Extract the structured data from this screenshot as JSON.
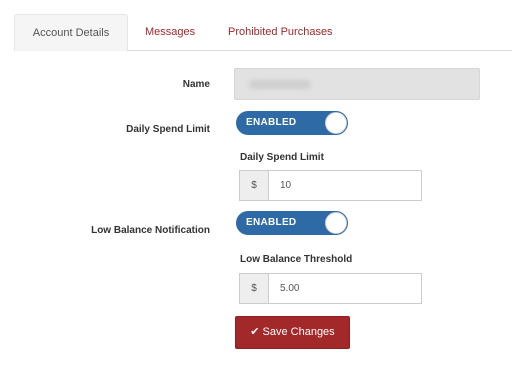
{
  "tabs": [
    {
      "label": "Account Details",
      "active": true
    },
    {
      "label": "Messages",
      "active": false
    },
    {
      "label": "Prohibited Purchases",
      "active": false
    }
  ],
  "form": {
    "name_label": "Name",
    "daily_spend": {
      "label": "Daily Spend Limit",
      "toggle_label": "ENABLED",
      "field_label": "Daily Spend Limit",
      "currency": "$",
      "value": "10"
    },
    "low_balance": {
      "label": "Low Balance Notification",
      "toggle_label": "ENABLED",
      "field_label": "Low Balance Threshold",
      "currency": "$",
      "value": "5.00"
    },
    "save_label": "Save Changes"
  },
  "colors": {
    "accent": "#a3282a",
    "toggle": "#2e6aa6"
  },
  "icons": {
    "save": "check-icon"
  }
}
